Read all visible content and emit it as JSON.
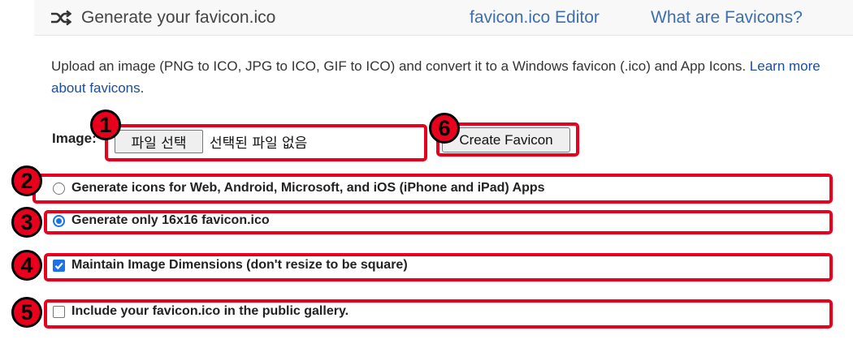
{
  "header": {
    "brand_icon": "shuffle-icon",
    "title": "Generate your favicon.ico",
    "nav": [
      {
        "label": "favicon.ico Editor"
      },
      {
        "label": "What are Favicons?"
      }
    ]
  },
  "intro": {
    "text": "Upload an image (PNG to ICO, JPG to ICO, GIF to ICO) and convert it to a Windows favicon (.ico) and App Icons. ",
    "link": "Learn more about favicons",
    "suffix": "."
  },
  "form": {
    "image_label": "Image:",
    "file_button": "파일 선택",
    "file_status": "선택된 파일 없음",
    "create_button": "Create Favicon",
    "options": [
      {
        "label": "Generate icons for Web, Android, Microsoft, and iOS (iPhone and iPad) Apps",
        "type": "radio",
        "checked": false
      },
      {
        "label": "Generate only 16x16 favicon.ico",
        "type": "radio",
        "checked": true
      },
      {
        "label": "Maintain Image Dimensions (don't resize to be square)",
        "type": "checkbox",
        "checked": true
      },
      {
        "label": "Include your favicon.ico in the public gallery.",
        "type": "checkbox",
        "checked": false
      }
    ]
  },
  "annotations": {
    "color": "#e8001c",
    "badges": [
      "1",
      "2",
      "3",
      "4",
      "5",
      "6"
    ]
  }
}
